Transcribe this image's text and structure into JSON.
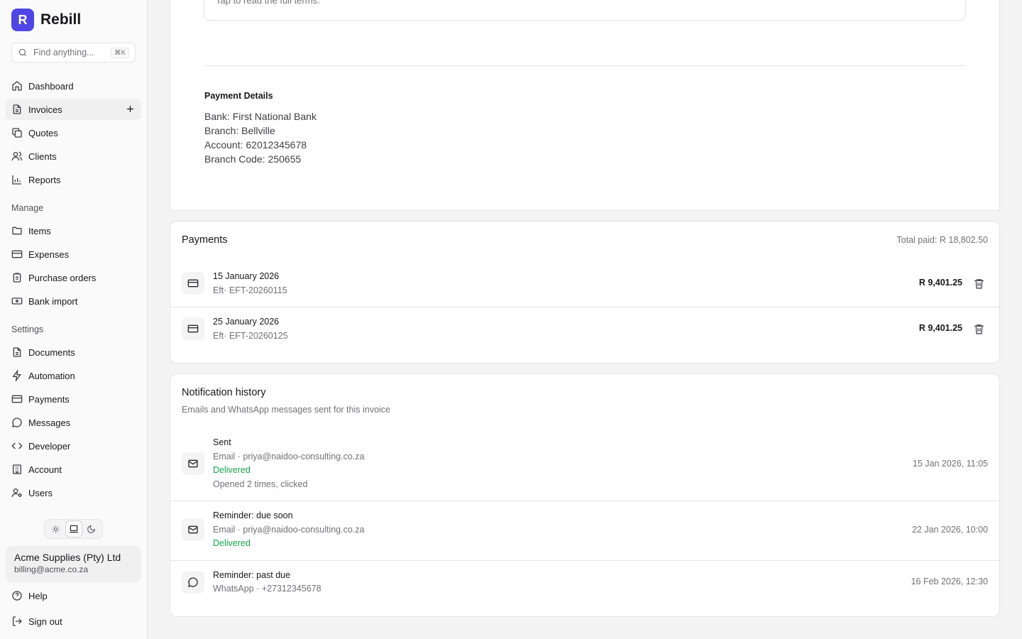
{
  "brand": {
    "logo_letter": "R",
    "name": "Rebill"
  },
  "search": {
    "placeholder": "Find anything...",
    "shortcut": "⌘K"
  },
  "nav": {
    "main": [
      {
        "label": "Dashboard",
        "icon": "home-icon"
      },
      {
        "label": "Invoices",
        "icon": "file-text-icon",
        "active": true
      },
      {
        "label": "Quotes",
        "icon": "copy-icon"
      },
      {
        "label": "Clients",
        "icon": "users-icon"
      },
      {
        "label": "Reports",
        "icon": "bar-chart-icon"
      }
    ],
    "manage_title": "Manage",
    "manage": [
      {
        "label": "Items",
        "icon": "folder-icon"
      },
      {
        "label": "Expenses",
        "icon": "credit-card-icon"
      },
      {
        "label": "Purchase orders",
        "icon": "clipboard-icon"
      },
      {
        "label": "Bank import",
        "icon": "banknote-icon"
      }
    ],
    "settings_title": "Settings",
    "settings": [
      {
        "label": "Documents",
        "icon": "file-icon"
      },
      {
        "label": "Automation",
        "icon": "zap-icon"
      },
      {
        "label": "Payments",
        "icon": "credit-card-icon"
      },
      {
        "label": "Messages",
        "icon": "message-circle-icon"
      },
      {
        "label": "Developer",
        "icon": "code-icon"
      },
      {
        "label": "Account",
        "icon": "building-icon"
      },
      {
        "label": "Users",
        "icon": "user-cog-icon"
      }
    ]
  },
  "theme_options": [
    "light",
    "system",
    "dark"
  ],
  "org": {
    "name": "Acme Supplies (Pty) Ltd",
    "email": "billing@acme.co.za"
  },
  "footer": {
    "help": "Help",
    "sign_out": "Sign out"
  },
  "terms": {
    "hint": "Tap to read the full terms."
  },
  "payment_details": {
    "title": "Payment Details",
    "lines": [
      "Bank: First National Bank",
      "Branch: Bellville",
      "Account: 62012345678",
      "Branch Code: 250655"
    ]
  },
  "payments": {
    "title": "Payments",
    "total_paid": "Total paid: R 18,802.50",
    "rows": [
      {
        "date": "15 January 2026",
        "ref": "Eft· EFT-20260115",
        "amount": "R 9,401.25"
      },
      {
        "date": "25 January 2026",
        "ref": "Eft· EFT-20260125",
        "amount": "R 9,401.25"
      }
    ]
  },
  "notifications": {
    "title": "Notification history",
    "subtitle": "Emails and WhatsApp messages sent for this invoice",
    "rows": [
      {
        "title": "Sent",
        "channel": "Email · priya@naidoo-consulting.co.za",
        "status": "Delivered",
        "extra": "Opened 2 times, clicked",
        "time": "15 Jan 2026, 11:05",
        "icon": "mail-icon"
      },
      {
        "title": "Reminder: due soon",
        "channel": "Email · priya@naidoo-consulting.co.za",
        "status": "Delivered",
        "time": "22 Jan 2026, 10:00",
        "icon": "mail-icon"
      },
      {
        "title": "Reminder: past due",
        "channel": "WhatsApp · +27312345678",
        "time": "16 Feb 2026, 12:30",
        "icon": "message-circle-icon"
      }
    ]
  },
  "colors": {
    "accent": "#4f46e5",
    "success": "#16a34a"
  }
}
